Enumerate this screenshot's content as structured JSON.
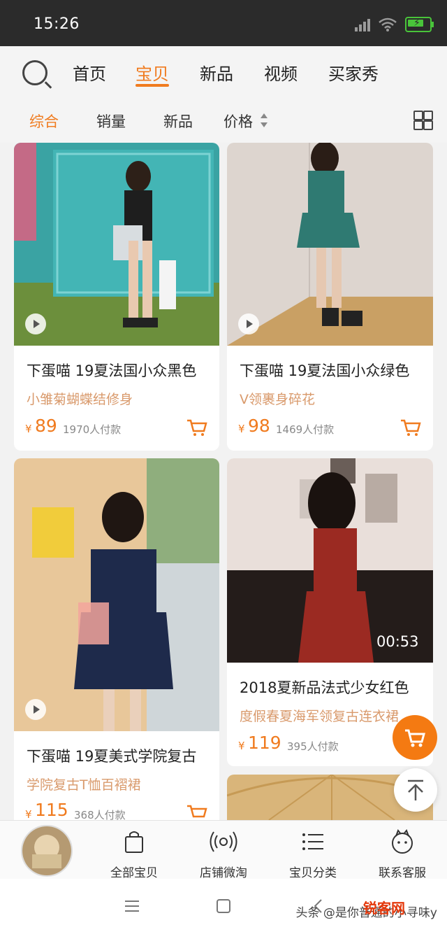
{
  "status": {
    "time": "15:26"
  },
  "nav": {
    "tabs": [
      "首页",
      "宝贝",
      "新品",
      "视频",
      "买家秀"
    ],
    "active_index": 1
  },
  "sort": {
    "items": [
      "综合",
      "销量",
      "新品",
      "价格"
    ],
    "active_index": 0
  },
  "products": [
    {
      "title": "下蛋喵 19夏法国小众黑色",
      "subtitle": "小雏菊蝴蝶结修身",
      "currency": "¥",
      "price": "89",
      "sold": "1970人付款",
      "has_video": true
    },
    {
      "title": "下蛋喵 19夏法国小众绿色",
      "subtitle": "V领裹身碎花",
      "currency": "¥",
      "price": "98",
      "sold": "1469人付款",
      "has_video": true
    },
    {
      "title": "下蛋喵 19夏美式学院复古",
      "subtitle": "学院复古T恤百褶裙",
      "currency": "¥",
      "price": "115",
      "sold": "368人付款",
      "has_video": true
    },
    {
      "title": "2018夏新品法式少女红色",
      "subtitle": "度假春夏海军领复古连衣裙",
      "currency": "¥",
      "price": "119",
      "sold": "395人付款",
      "has_video": true,
      "duration": "00:53"
    }
  ],
  "bottom_tabs": [
    {
      "label": "全部宝贝",
      "icon": "shopping-bag-icon"
    },
    {
      "label": "店铺微淘",
      "icon": "broadcast-icon"
    },
    {
      "label": "宝贝分类",
      "icon": "list-icon"
    },
    {
      "label": "联系客服",
      "icon": "customer-service-icon"
    }
  ],
  "watermark": {
    "prefix": "头条 @是你普通的小寻味y",
    "brand": "锐客网"
  },
  "colors": {
    "accent": "#f07b1f",
    "subtitle": "#d99a6c",
    "status_bar": "#2b2b2b"
  }
}
